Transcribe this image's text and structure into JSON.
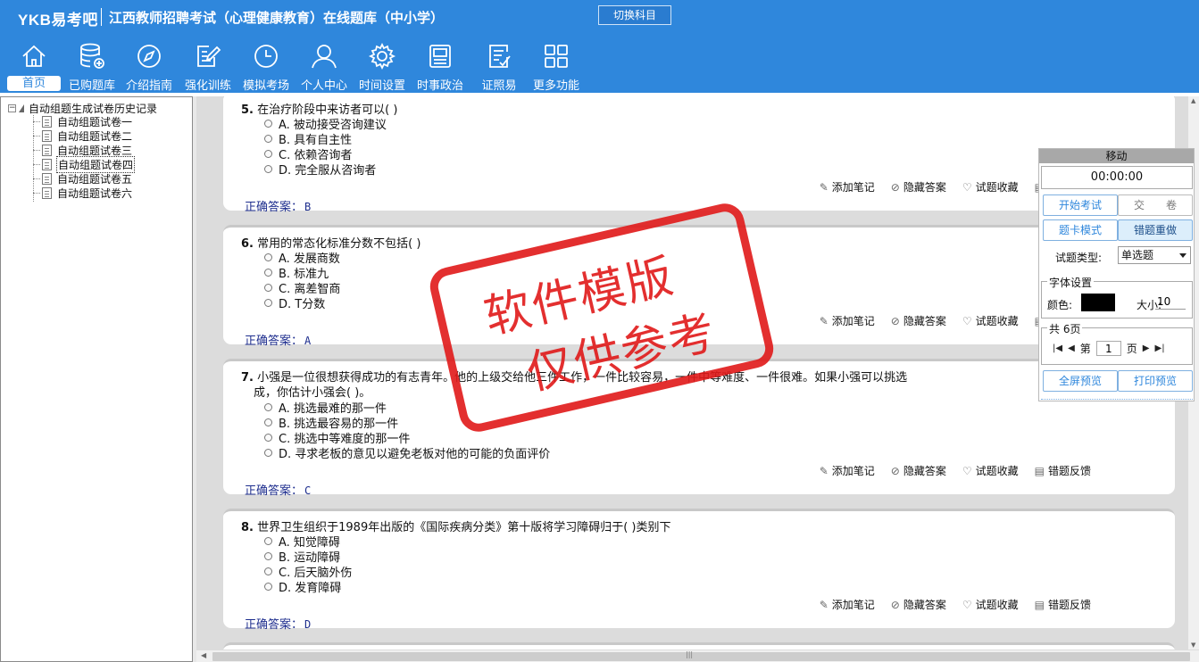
{
  "header": {
    "brand": "YKB易考吧",
    "title": "江西教师招聘考试（心理健康教育）在线题库（中小学）",
    "switch_subject": "切换科目"
  },
  "nav": [
    {
      "label": "首页",
      "icon": "home-icon",
      "active": true
    },
    {
      "label": "已购题库",
      "icon": "database-icon"
    },
    {
      "label": "介绍指南",
      "icon": "compass-icon"
    },
    {
      "label": "强化训练",
      "icon": "edit-icon"
    },
    {
      "label": "模拟考场",
      "icon": "clock-icon"
    },
    {
      "label": "个人中心",
      "icon": "user-icon"
    },
    {
      "label": "时间设置",
      "icon": "gear-icon"
    },
    {
      "label": "时事政治",
      "icon": "news-icon"
    },
    {
      "label": "证照易",
      "icon": "checklist-icon"
    },
    {
      "label": "更多功能",
      "icon": "grid-icon"
    }
  ],
  "tree": {
    "toggle": "−",
    "root": "自动组题生成试卷历史记录",
    "items": [
      "自动组题试卷一",
      "自动组题试卷二",
      "自动组题试卷三",
      "自动组题试卷四",
      "自动组题试卷五",
      "自动组题试卷六"
    ],
    "selected_index": 3
  },
  "questions": [
    {
      "number": "5.",
      "stem": "在治疗阶段中来访者可以(    )",
      "options": [
        "A. 被动接受咨询建议",
        "B. 具有自主性",
        "C. 依赖咨询者",
        "D. 完全服从咨询者"
      ],
      "answer": "B"
    },
    {
      "number": "6.",
      "stem": "常用的常态化标准分数不包括(    )",
      "options": [
        "A. 发展商数",
        "B. 标准九",
        "C. 离差智商",
        "D. T分数"
      ],
      "answer": "A"
    },
    {
      "number": "7.",
      "stem": "小强是一位很想获得成功的有志青年。他的上级交给他三件工作，一件比较容易，一件中等难度、一件很难。如果小强可以挑选",
      "stem_line2": "成，你估计小强会(    )。",
      "options": [
        "A. 挑选最难的那一件",
        "B. 挑选最容易的那一件",
        "C. 挑选中等难度的那一件",
        "D. 寻求老板的意见以避免老板对他的可能的负面评价"
      ],
      "answer": "C"
    },
    {
      "number": "8.",
      "stem": "世界卫生组织于1989年出版的《国际疾病分类》第十版将学习障碍归于(    )类别下",
      "options": [
        "A. 知觉障碍",
        "B. 运动障碍",
        "C. 后天脑外伤",
        "D. 发育障碍"
      ],
      "answer": "D"
    }
  ],
  "actions": {
    "note": "添加笔记",
    "hide_answer": "隐藏答案",
    "favorite": "试题收藏",
    "feedback": "错题反馈",
    "answer_label": "正确答案："
  },
  "panel": {
    "title": "移动",
    "timer": "00:00:00",
    "start_exam": "开始考试",
    "submit": "交　　卷",
    "card_mode": "题卡模式",
    "redo_wrong": "错题重做",
    "type_label": "试题类型:",
    "type_value": "单选题",
    "font_group": "字体设置",
    "color_label": "颜色:",
    "font_color": "#000000",
    "size_label": "大小:",
    "size_value": "10",
    "pages_label": "共 6页",
    "page_prefix": "第",
    "page_value": "1",
    "page_suffix": "页",
    "fullscreen": "全屏预览",
    "print": "打印预览"
  },
  "watermark": {
    "line1": "软件模版",
    "line2": "仅供参考"
  },
  "colors": {
    "header_bg": "#2f87dc",
    "stamp": "#e01919",
    "answer_text": "#1e2e8e"
  }
}
